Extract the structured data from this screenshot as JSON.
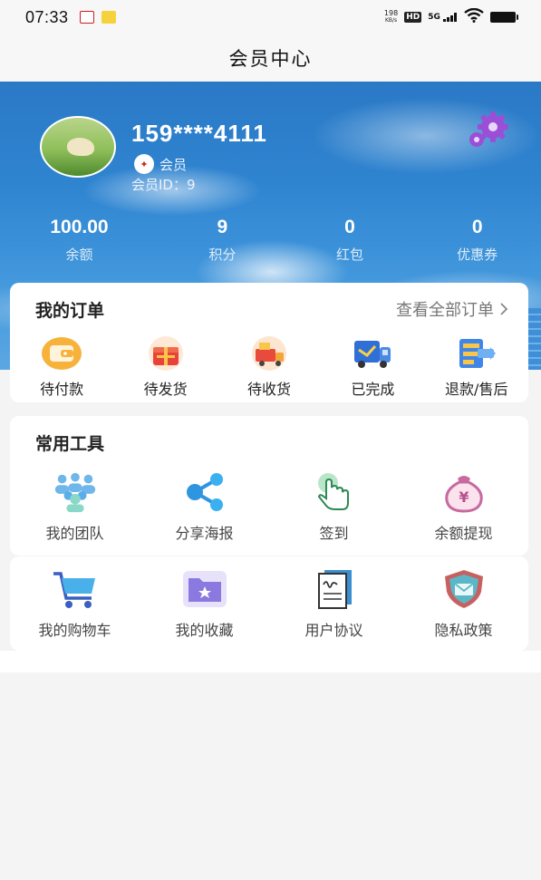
{
  "status_bar": {
    "time": "07:33",
    "net_speed_value": "198",
    "net_speed_unit": "KB/s",
    "hd": "HD",
    "network": "5G"
  },
  "nav": {
    "title": "会员中心"
  },
  "user": {
    "phone": "159****4111",
    "level": "会员",
    "member_id": "会员ID：9"
  },
  "stats": [
    {
      "value": "100.00",
      "label": "余额"
    },
    {
      "value": "9",
      "label": "积分"
    },
    {
      "value": "0",
      "label": "红包"
    },
    {
      "value": "0",
      "label": "优惠券"
    }
  ],
  "orders": {
    "title": "我的订单",
    "view_all": "查看全部订单",
    "items": [
      {
        "label": "待付款",
        "icon": "wallet-icon"
      },
      {
        "label": "待发货",
        "icon": "gift-box-icon"
      },
      {
        "label": "待收货",
        "icon": "delivery-truck-icon"
      },
      {
        "label": "已完成",
        "icon": "completed-truck-icon"
      },
      {
        "label": "退款/售后",
        "icon": "refund-icon"
      }
    ]
  },
  "tools": {
    "title": "常用工具",
    "items": [
      {
        "label": "我的团队",
        "icon": "team-icon"
      },
      {
        "label": "分享海报",
        "icon": "share-icon"
      },
      {
        "label": "签到",
        "icon": "tap-hand-icon"
      },
      {
        "label": "余额提现",
        "icon": "money-bag-icon"
      },
      {
        "label": "我的购物车",
        "icon": "shopping-cart-icon"
      },
      {
        "label": "我的收藏",
        "icon": "favorites-folder-icon"
      },
      {
        "label": "用户协议",
        "icon": "agreement-document-icon"
      },
      {
        "label": "隐私政策",
        "icon": "privacy-shield-icon"
      }
    ]
  },
  "colors": {
    "banner_blue": "#2f84d0",
    "card_bg": "#ffffff",
    "page_bg": "#f4f4f4",
    "orange": "#f5a623",
    "purple": "#8e6fd8"
  }
}
